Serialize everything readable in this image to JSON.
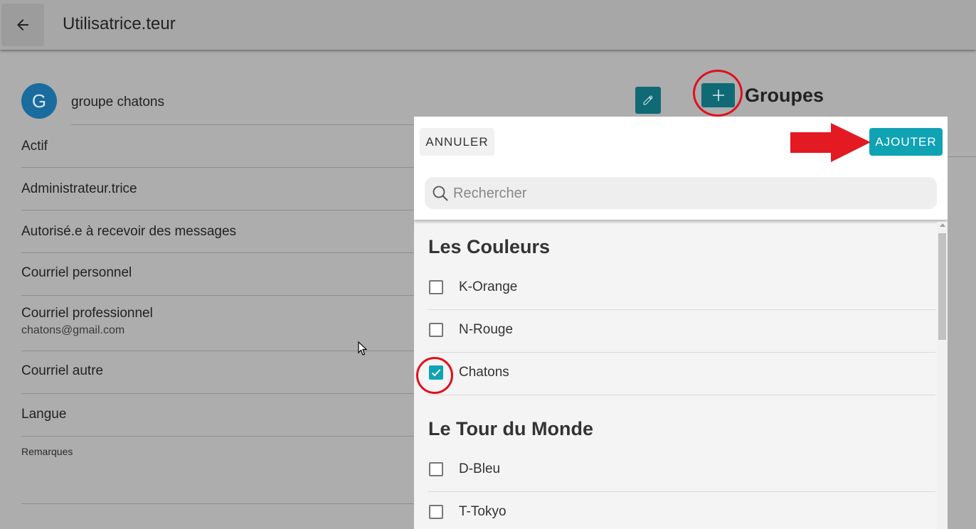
{
  "header": {
    "title": "Utilisatrice.teur",
    "back_icon": "arrow-left-icon"
  },
  "profile": {
    "avatar_letter": "G",
    "name": "groupe chatons"
  },
  "fields": [
    {
      "label": "Actif",
      "value": ""
    },
    {
      "label": "Administrateur.trice",
      "value": ""
    },
    {
      "label": "Autorisé.e à recevoir des messages",
      "value": ""
    },
    {
      "label": "Courriel personnel",
      "value": ""
    },
    {
      "label": "Courriel professionnel",
      "value": "chatons@gmail.com"
    },
    {
      "label": "Courriel autre",
      "value": ""
    },
    {
      "label": "Langue",
      "value": ""
    },
    {
      "label": "Remarques",
      "value": ""
    }
  ],
  "groups_panel": {
    "title": "Groupes",
    "add_icon": "plus-icon",
    "edit_icon": "pencil-icon"
  },
  "dialog": {
    "cancel_label": "ANNULER",
    "submit_label": "AJOUTER",
    "search": {
      "placeholder": "Rechercher",
      "value": ""
    },
    "sections": [
      {
        "title": "Les Couleurs",
        "items": [
          {
            "label": "K-Orange",
            "checked": false
          },
          {
            "label": "N-Rouge",
            "checked": false
          },
          {
            "label": "Chatons",
            "checked": true
          }
        ]
      },
      {
        "title": "Le Tour du Monde",
        "items": [
          {
            "label": "D-Bleu",
            "checked": false
          },
          {
            "label": "T-Tokyo",
            "checked": false
          }
        ]
      }
    ]
  },
  "colors": {
    "accent": "#0fa3b3",
    "accent_dark": "#0f6a76",
    "annotation": "#e0101d"
  }
}
